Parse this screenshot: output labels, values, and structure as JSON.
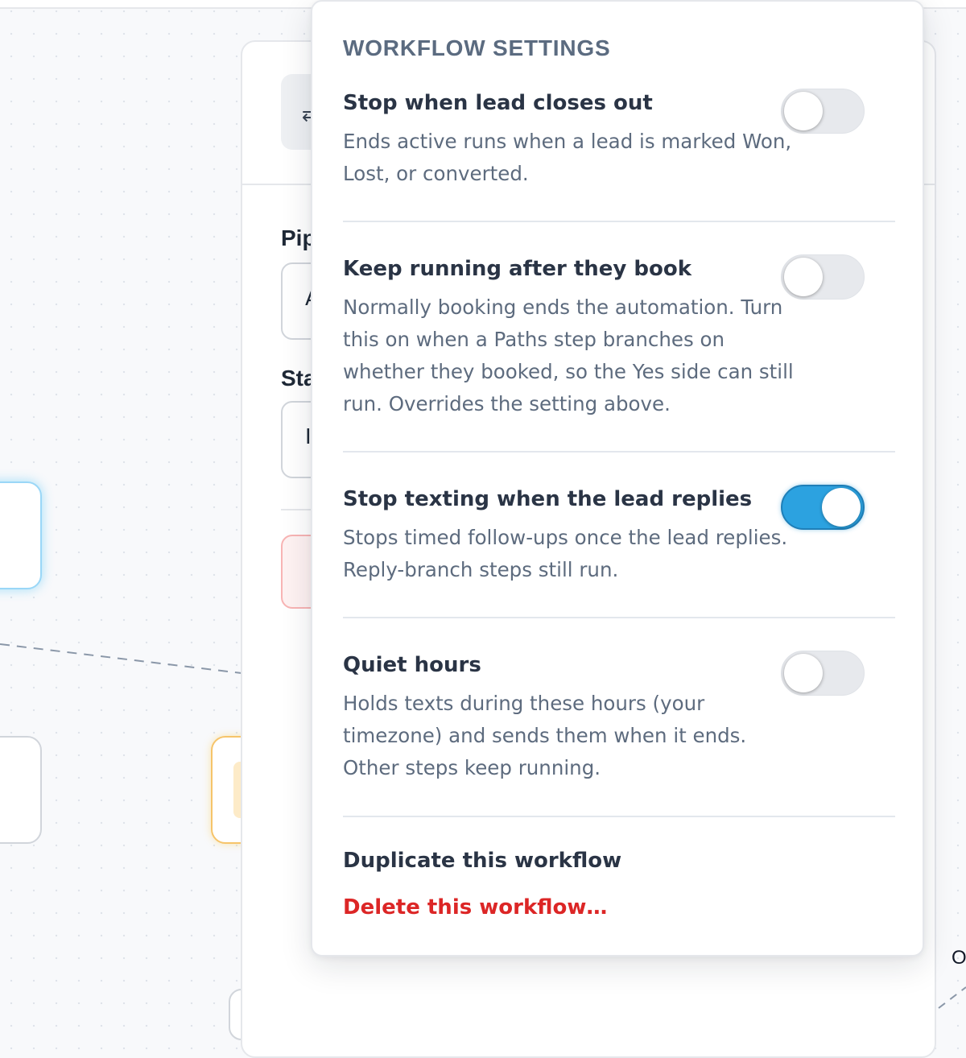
{
  "side_panel": {
    "icon_button_glyph": "⇄",
    "field_labels": [
      "Pip",
      "Sta"
    ],
    "field_values": [
      "A",
      "I"
    ]
  },
  "canvas": {
    "edge_label": "O"
  },
  "settings": {
    "heading": "WORKFLOW SETTINGS",
    "items": [
      {
        "title": "Stop when lead closes out",
        "description": "Ends active runs when a lead is marked Won, Lost, or converted.",
        "enabled": false
      },
      {
        "title": "Keep running after they book",
        "description": "Normally booking ends the automation. Turn this on when a Paths step branches on whether they booked, so the Yes side can still run. Overrides the setting above.",
        "enabled": false
      },
      {
        "title": "Stop texting when the lead replies",
        "description": "Stops timed follow-ups once the lead replies. Reply-branch steps still run.",
        "enabled": true
      },
      {
        "title": "Quiet hours",
        "description": "Holds texts during these hours (your timezone) and sends them when it ends. Other steps keep running.",
        "enabled": false
      }
    ],
    "actions": {
      "duplicate": "Duplicate this workflow",
      "delete": "Delete this workflow…"
    }
  },
  "colors": {
    "toggle_on": "#2ca2e0",
    "toggle_off": "#e7e9ed",
    "danger": "#dc2626",
    "heading": "#5b6b80"
  }
}
